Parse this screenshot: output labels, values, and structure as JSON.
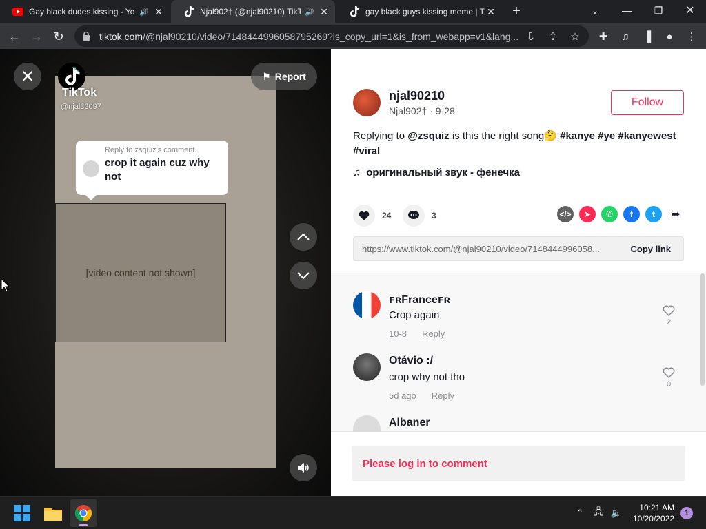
{
  "browser": {
    "tabs": [
      {
        "title": "Gay black dudes kissing - Yo",
        "favicon": "youtube-icon",
        "audio": true,
        "active": false
      },
      {
        "title": "Njal902† (@njal90210) TikTo",
        "favicon": "tiktok-icon",
        "audio": true,
        "active": true
      },
      {
        "title": "gay black guys kissing meme | Ti",
        "favicon": "tiktok-icon",
        "audio": false,
        "active": false
      }
    ],
    "url_host": "tiktok.com",
    "url_path": "/@njal90210/video/7148444996058795269?is_copy_url=1&is_from_webapp=v1&lang..."
  },
  "video": {
    "report_label": "Report",
    "watermark_name": "TikTok",
    "watermark_handle": "@njal32097",
    "reply_to": "Reply to zsquiz's comment",
    "reply_text": "crop it again cuz why not",
    "placeholder_text": "[video content not shown]"
  },
  "post": {
    "username": "njal90210",
    "display_name": "Njal902† · 9-28",
    "follow_label": "Follow",
    "caption_prefix": "Replying to ",
    "caption_mention": "@zsquiz",
    "caption_text": " is this the right song🤔 ",
    "caption_tags": "#kanye #ye #kanyewest #viral",
    "music": "оригинальный звук - фенечка",
    "likes": "24",
    "comments_count": "3",
    "share_url": "https://www.tiktok.com/@njal90210/video/7148444996058...",
    "copy_link_label": "Copy link"
  },
  "comments": [
    {
      "name": "ꜰʀFranceꜰʀ",
      "text": "Crop again",
      "date": "10-8",
      "reply": "Reply",
      "likes": "2"
    },
    {
      "name": "Otávio :/",
      "text": "crop why not tho",
      "date": "5d ago",
      "reply": "Reply",
      "likes": "0"
    },
    {
      "name": "Albaner",
      "text": "",
      "date": "",
      "reply": "",
      "likes": ""
    }
  ],
  "login_prompt": "Please log in to comment",
  "taskbar": {
    "time": "10:21 AM",
    "date": "10/20/2022",
    "notifications": "1"
  },
  "colors": {
    "tiktok_red": "#fe2c55",
    "whatsapp": "#25d366",
    "facebook": "#1877f2",
    "twitter": "#1da1f2",
    "embed": "#616161",
    "friends": "#fe2c55"
  }
}
